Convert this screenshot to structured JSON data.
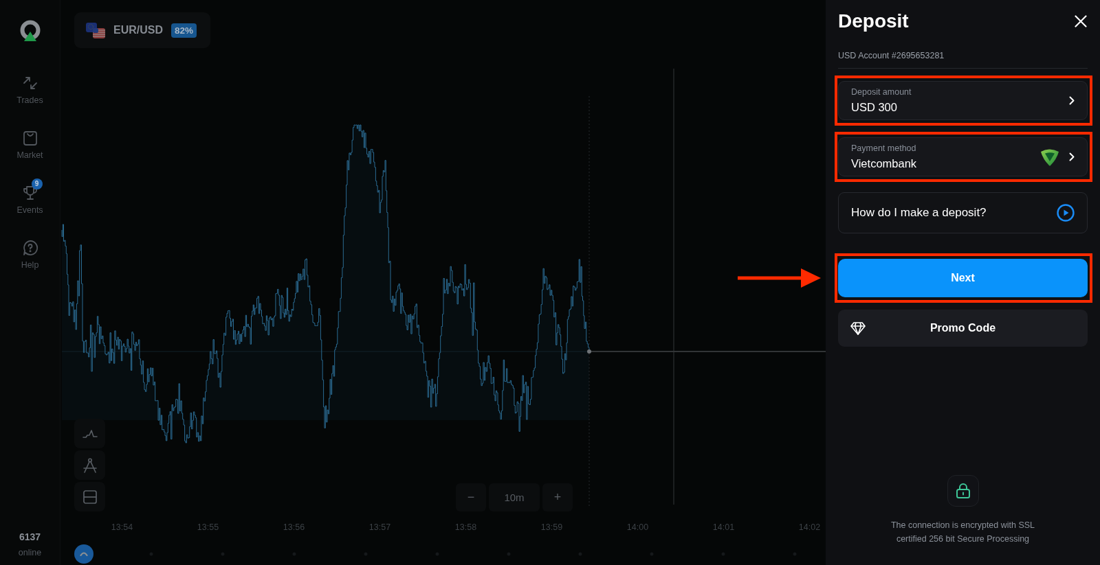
{
  "sidebar": {
    "items": [
      {
        "label": "Trades"
      },
      {
        "label": "Market"
      },
      {
        "label": "Events",
        "badge": "9"
      },
      {
        "label": "Help"
      }
    ],
    "online_count": "6137",
    "online_label": "online"
  },
  "asset": {
    "pair": "EUR/USD",
    "payout": "82%"
  },
  "chart": {
    "zoom": {
      "decrease": "−",
      "value": "10m",
      "increase": "+"
    },
    "time_labels": [
      "13:54",
      "13:55",
      "13:56",
      "13:57",
      "13:58",
      "13:59",
      "14:00",
      "14:01",
      "14:02"
    ]
  },
  "deposit_panel": {
    "title": "Deposit",
    "account": "USD Account #2695653281",
    "fields": [
      {
        "kind": "plain",
        "label": "Deposit amount",
        "value": "USD 300",
        "highlighted": true
      },
      {
        "kind": "with_logo",
        "label": "Payment method",
        "value": "Vietcombank",
        "highlighted": true
      }
    ],
    "help_link": {
      "label": "How do I make a deposit?",
      "highlighted": false
    },
    "next_button": {
      "label": "Next",
      "highlighted": true,
      "pointer_arrow": true
    },
    "promo_button": {
      "label": "Promo Code",
      "highlighted": false
    },
    "security_note": "The connection is encrypted with SSL certified 256 bit Secure Processing"
  }
}
